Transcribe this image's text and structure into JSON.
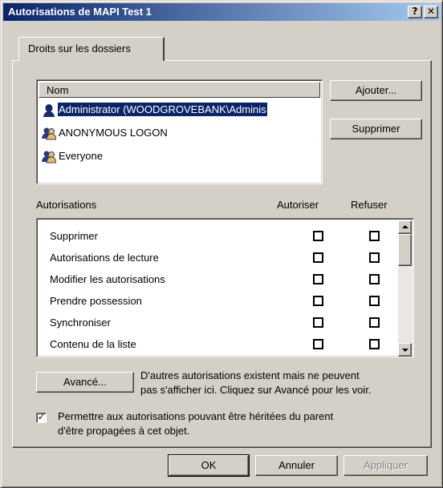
{
  "window": {
    "title": "Autorisations de MAPI Test 1",
    "help_glyph": "?",
    "close_glyph": "✕"
  },
  "tabs": [
    {
      "label": "Droits sur les dossiers"
    }
  ],
  "users": {
    "header": "Nom",
    "items": [
      {
        "label": "Administrator (WOODGROVEBANK\\Adminis",
        "icon": "user-icon",
        "selected": true
      },
      {
        "label": "ANONYMOUS LOGON",
        "icon": "group-icon",
        "selected": false
      },
      {
        "label": "Everyone",
        "icon": "group-icon",
        "selected": false
      }
    ]
  },
  "buttons": {
    "add": "Ajouter...",
    "remove": "Supprimer",
    "advanced": "Avancé...",
    "ok": "OK",
    "cancel": "Annuler",
    "apply": "Appliquer"
  },
  "permissions": {
    "heading": "Autorisations",
    "allow_col": "Autoriser",
    "deny_col": "Refuser",
    "items": [
      {
        "label": "Supprimer",
        "allow": false,
        "deny": false
      },
      {
        "label": "Autorisations de lecture",
        "allow": false,
        "deny": false
      },
      {
        "label": "Modifier les autorisations",
        "allow": false,
        "deny": false
      },
      {
        "label": "Prendre possession",
        "allow": false,
        "deny": false
      },
      {
        "label": "Synchroniser",
        "allow": false,
        "deny": false
      },
      {
        "label": "Contenu de la liste",
        "allow": false,
        "deny": false
      }
    ]
  },
  "advanced_note": {
    "line1": "D'autres autorisations existent mais ne peuvent",
    "line2": "pas s'afficher ici. Cliquez sur Avancé pour les voir."
  },
  "inherit": {
    "checked": true,
    "line1": "Permettre aux autorisations pouvant être héritées du parent",
    "line2": "d'être propagées à cet objet."
  }
}
